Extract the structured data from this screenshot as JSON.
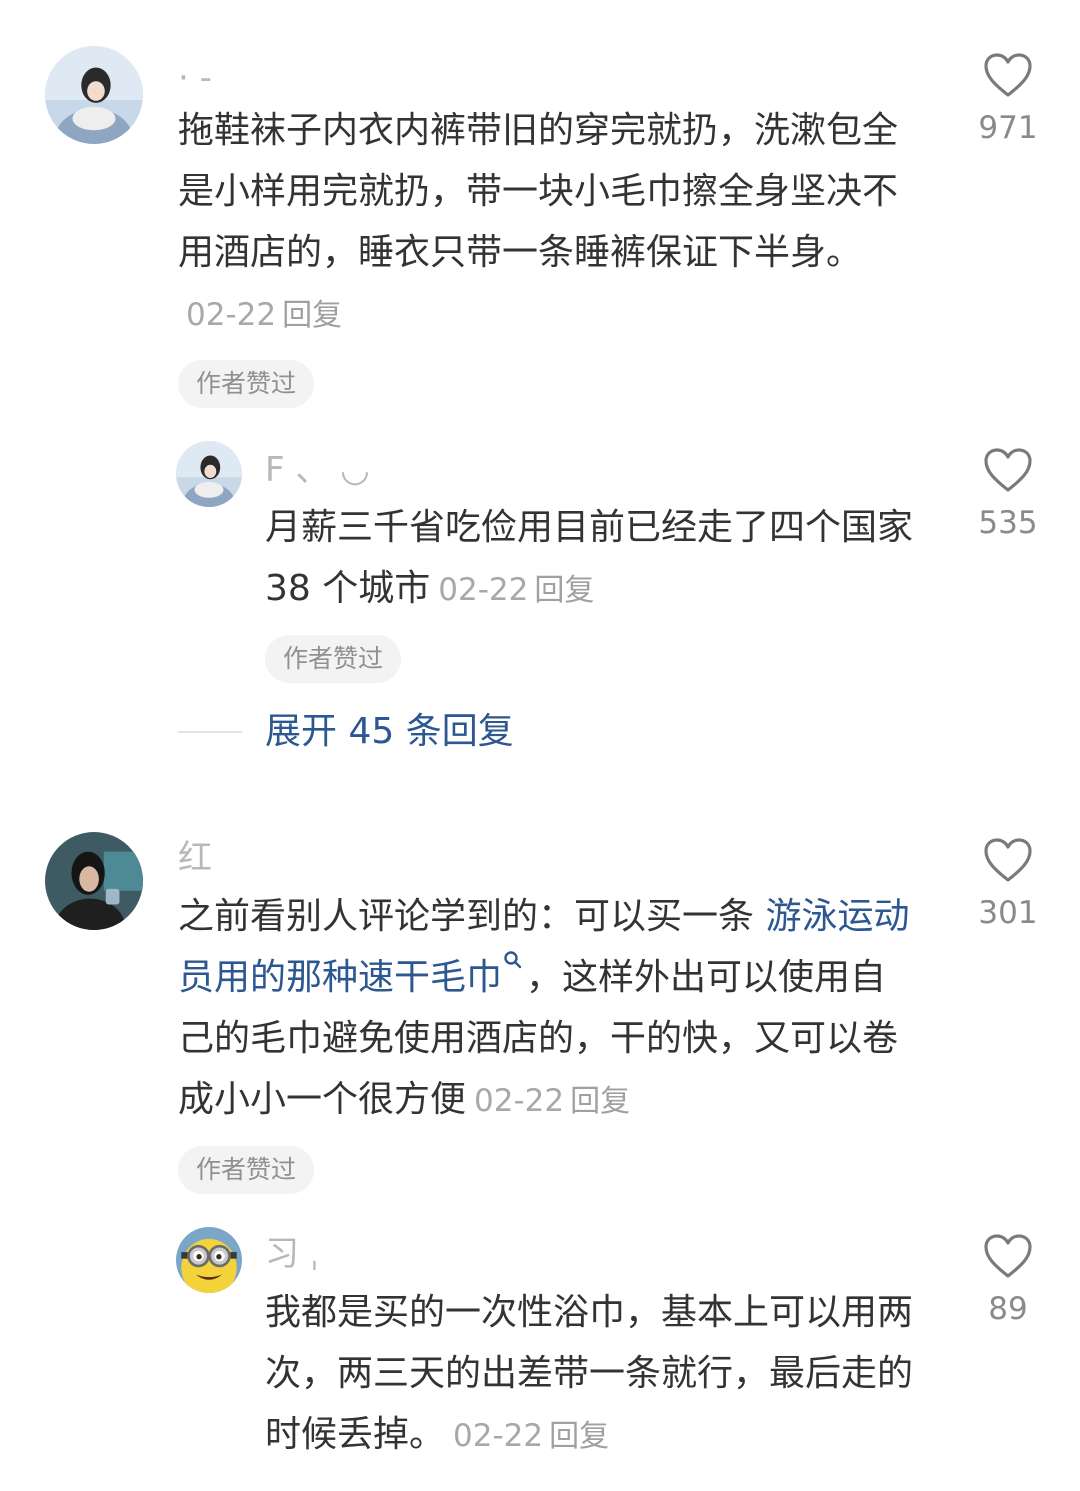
{
  "comments": [
    {
      "username": "· -",
      "text": "拖鞋袜子内衣内裤带旧的穿完就扔，洗漱包全是小样用完就扔，带一块小毛巾擦全身坚决不用酒店的，睡衣只带一条睡裤保证下半身。",
      "date": "02-22",
      "reply_label": "回复",
      "badge": "作者赞过",
      "likes": "971",
      "reply": {
        "username": "F          、 ◡",
        "text": "月薪三千省吃俭用目前已经走了四个国家 38 个城市",
        "date": "02-22",
        "reply_label": "回复",
        "badge": "作者赞过",
        "likes": "535"
      },
      "expand_label": "展开 45 条回复"
    },
    {
      "username": "红",
      "text_before": "之前看别人评论学到的：可以买一条 ",
      "link_text": "游泳运动员用的那种速干毛巾",
      "text_after": "，这样外出可以使用自己的毛巾避免使用酒店的，干的快，又可以卷成小小一个很方便",
      "date": "02-22",
      "reply_label": "回复",
      "badge": "作者赞过",
      "likes": "301",
      "reply": {
        "username": "习 ˌ",
        "text": "我都是买的一次性浴巾，基本上可以用两次，两三天的出差带一条就行，最后走的时候丢掉。",
        "date": "02-22",
        "reply_label": "回复",
        "likes": "89"
      }
    }
  ],
  "colors": {
    "link": "#2d5791",
    "muted": "#a8a8a8",
    "text": "#333333",
    "badge_bg": "#f3f3f3"
  }
}
